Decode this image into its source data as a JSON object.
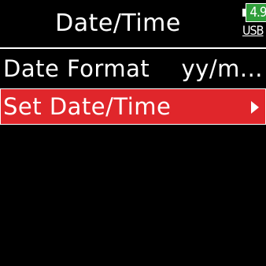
{
  "header": {
    "title": "Date/Time",
    "battery_voltage": "4.9",
    "power_source": "USB",
    "battery_color": "#2f9e3a"
  },
  "menu": {
    "items": [
      {
        "label": "Date Format",
        "value": "yy/m...",
        "selected": false
      },
      {
        "label": "Set Date/Time",
        "value": "",
        "selected": true,
        "arrow_icon": "arrow-right-icon"
      }
    ],
    "selection_color": "#e0262b"
  }
}
